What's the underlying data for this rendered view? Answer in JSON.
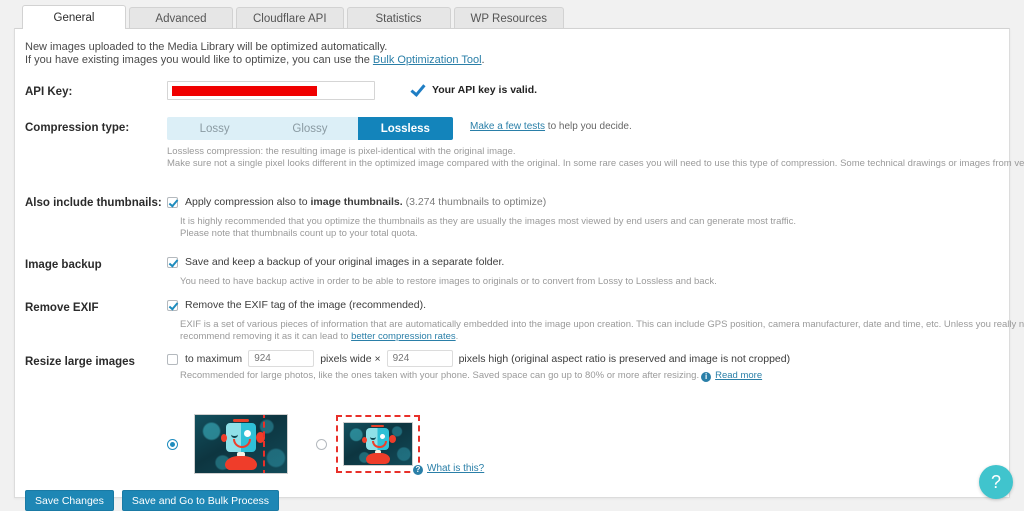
{
  "tabs": [
    {
      "label": "General",
      "active": true
    },
    {
      "label": "Advanced",
      "active": false
    },
    {
      "label": "Cloudflare API",
      "active": false
    },
    {
      "label": "Statistics",
      "active": false
    },
    {
      "label": "WP Resources",
      "active": false
    }
  ],
  "intro": {
    "line1": "New images uploaded to the Media Library will be optimized automatically.",
    "line2_prefix": "If you have existing images you would like to optimize, you can use the ",
    "line2_link": "Bulk Optimization Tool",
    "line2_suffix": "."
  },
  "api_key": {
    "label": "API Key:",
    "value": "",
    "placeholder": "",
    "status_text": "Your API key is valid.",
    "check_icon": "check-icon"
  },
  "compression": {
    "label": "Compression type:",
    "options": [
      "Lossy",
      "Glossy",
      "Lossless"
    ],
    "selected": "Lossless",
    "aside_link": "Make a few tests",
    "aside_text": " to help you decide.",
    "desc1": "Lossless compression: the resulting image is pixel-identical with the original image.",
    "desc2": "Make sure not a single pixel looks different in the optimized image compared with the original. In some rare cases you will need to use this type of compression. Some technical drawings or images from vector graphics are possible situations."
  },
  "thumbnails": {
    "label": "Also include thumbnails:",
    "checked": true,
    "text_prefix": "Apply compression also to ",
    "text_bold": "image thumbnails.",
    "count_text": "(3.274 thumbnails to optimize)",
    "desc1": "It is highly recommended that you optimize the thumbnails as they are usually the images most viewed by end users and can generate most traffic.",
    "desc2": "Please note that thumbnails count up to your total quota."
  },
  "backup": {
    "label": "Image backup",
    "checked": true,
    "text": "Save and keep a backup of your original images in a separate folder.",
    "desc": "You need to have backup active in order to be able to restore images to originals or to convert from Lossy to Lossless and back."
  },
  "exif": {
    "label": "Remove EXIF",
    "checked": true,
    "text": "Remove the EXIF tag of the image (recommended).",
    "desc1": "EXIF is a set of various pieces of information that are automatically embedded into the image upon creation. This can include GPS position, camera manufacturer, date and time, etc. Unless you really need that data to be preserved, we",
    "desc2_prefix": "recommend removing it as it can lead to ",
    "desc2_link": "better compression rates",
    "desc2_suffix": "."
  },
  "resize": {
    "label": "Resize large images",
    "checked": false,
    "text_to_max": "to maximum",
    "width_placeholder": "924",
    "width_value": "",
    "between_text": "pixels wide ×",
    "height_placeholder": "924",
    "height_value": "",
    "after_text": "pixels high (original aspect ratio is preserved and image is not cropped)",
    "desc_prefix": "Recommended for large photos, like the ones taken with your phone. Saved space can go up to 80% or more after resizing.",
    "desc_link": "Read more",
    "info_icon": "info-icon",
    "mode_selected": "preserve-aspect-ratio",
    "what_is_this_link": "What is this?",
    "what_is_this_icon": "info-icon"
  },
  "footer": {
    "save_label": "Save Changes",
    "bulk_label": "Save and Go to Bulk Process"
  },
  "help_fab": {
    "icon": "question-mark-icon",
    "label": "?",
    "color": "#40c4cd"
  },
  "colors": {
    "accent": "#1e87b5",
    "switch_active": "#1384bb",
    "switch_inactive_bg": "#dceff7",
    "link": "#2a7fa8",
    "redaction": "#f00000",
    "help_fab": "#40c4cd"
  }
}
